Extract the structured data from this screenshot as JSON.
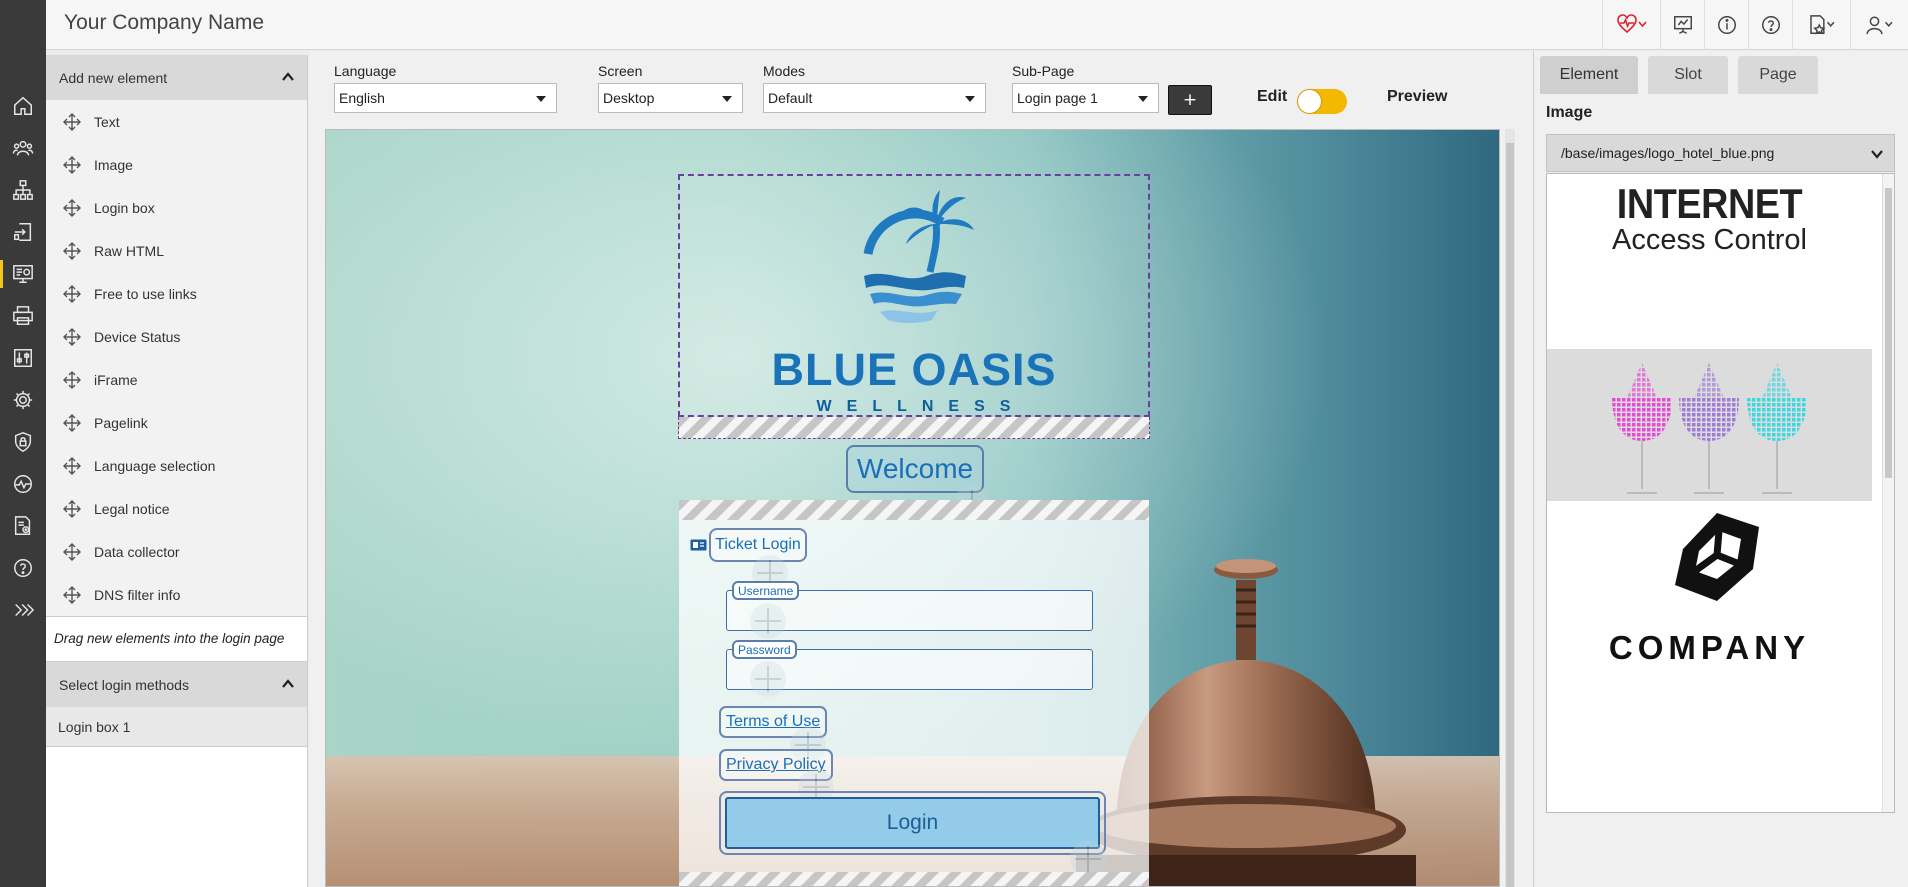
{
  "app": {
    "company_name": "Your Company Name"
  },
  "rail": {
    "icons": [
      "home-icon",
      "users-icon",
      "hierarchy-icon",
      "login-icon",
      "portal-design-icon",
      "printer-icon",
      "sliders-icon",
      "gear-icon",
      "shield-icon",
      "monitor-icon",
      "report-icon",
      "help-icon",
      "expand-icon"
    ],
    "active_index": 4,
    "accent": "#f5c518"
  },
  "topbar": {
    "icons": [
      "health-status-icon",
      "presentation-icon",
      "info-icon",
      "help-icon",
      "bookmark-star-icon",
      "user-icon"
    ],
    "health_color": "#d9232d"
  },
  "left_panel": {
    "add_header": "Add new element",
    "elements": [
      "Text",
      "Image",
      "Login box",
      "Raw HTML",
      "Free to use links",
      "Device Status",
      "iFrame",
      "Pagelink",
      "Language selection",
      "Legal notice",
      "Data collector",
      "DNS filter info"
    ],
    "hint": "Drag new elements into the login page",
    "methods_header": "Select login methods",
    "methods": [
      "Login box 1"
    ]
  },
  "toolbar": {
    "language": {
      "label": "Language",
      "value": "English"
    },
    "screen": {
      "label": "Screen",
      "value": "Desktop"
    },
    "modes": {
      "label": "Modes",
      "value": "Default"
    },
    "subpage": {
      "label": "Sub-Page",
      "value": "Login page 1"
    },
    "add_label": "+",
    "edit_label": "Edit",
    "preview_label": "Preview",
    "toggle_color": "#f5b800"
  },
  "canvas": {
    "logo_title": "BLUE OASIS",
    "logo_subtitle": "WELLNESS",
    "welcome": "Welcome",
    "ticket_login": "Ticket Login",
    "username_label": "Username",
    "password_label": "Password",
    "terms": "Terms of Use",
    "privacy": "Privacy Policy",
    "login_button": "Login",
    "brand_color": "#1a72b8"
  },
  "right_panel": {
    "tabs": [
      "Element",
      "Slot",
      "Page"
    ],
    "active_tab": "Element",
    "image_label": "Image",
    "image_path": "/base/images/logo_hotel_blue.png",
    "gallery": {
      "item1_line1": "INTERNET",
      "item1_line2": "Access Control",
      "item3_text": "COMPANY"
    }
  }
}
